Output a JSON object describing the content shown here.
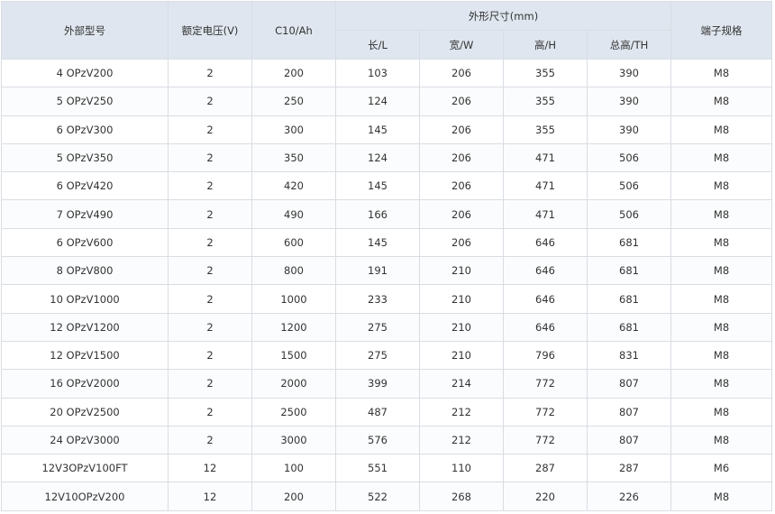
{
  "header": {
    "model": "外部型号",
    "voltage": "额定电压(V)",
    "capacity": "C10/Ah",
    "dimensions": "外形尺寸(mm)",
    "length": "长/L",
    "width": "宽/W",
    "height": "高/H",
    "total_height": "总高/TH",
    "terminal": "端子规格"
  },
  "rows": [
    [
      "4 OPzV200",
      "2",
      "200",
      "103",
      "206",
      "355",
      "390",
      "M8"
    ],
    [
      "5 OPzV250",
      "2",
      "250",
      "124",
      "206",
      "355",
      "390",
      "M8"
    ],
    [
      "6 OPzV300",
      "2",
      "300",
      "145",
      "206",
      "355",
      "390",
      "M8"
    ],
    [
      "5 OPzV350",
      "2",
      "350",
      "124",
      "206",
      "471",
      "506",
      "M8"
    ],
    [
      "6 OPzV420",
      "2",
      "420",
      "145",
      "206",
      "471",
      "506",
      "M8"
    ],
    [
      "7 OPzV490",
      "2",
      "490",
      "166",
      "206",
      "471",
      "506",
      "M8"
    ],
    [
      "6 OPzV600",
      "2",
      "600",
      "145",
      "206",
      "646",
      "681",
      "M8"
    ],
    [
      "8 OPzV800",
      "2",
      "800",
      "191",
      "210",
      "646",
      "681",
      "M8"
    ],
    [
      "10 OPzV1000",
      "2",
      "1000",
      "233",
      "210",
      "646",
      "681",
      "M8"
    ],
    [
      "12 OPzV1200",
      "2",
      "1200",
      "275",
      "210",
      "646",
      "681",
      "M8"
    ],
    [
      "12 OPzV1500",
      "2",
      "1500",
      "275",
      "210",
      "796",
      "831",
      "M8"
    ],
    [
      "16 OPzV2000",
      "2",
      "2000",
      "399",
      "214",
      "772",
      "807",
      "M8"
    ],
    [
      "20 OPzV2500",
      "2",
      "2500",
      "487",
      "212",
      "772",
      "807",
      "M8"
    ],
    [
      "24 OPzV3000",
      "2",
      "3000",
      "576",
      "212",
      "772",
      "807",
      "M8"
    ],
    [
      "12V3OPzV100FT",
      "12",
      "100",
      "551",
      "110",
      "287",
      "287",
      "M6"
    ],
    [
      "12V10OPzV200",
      "12",
      "200",
      "522",
      "268",
      "220",
      "226",
      "M8"
    ]
  ]
}
